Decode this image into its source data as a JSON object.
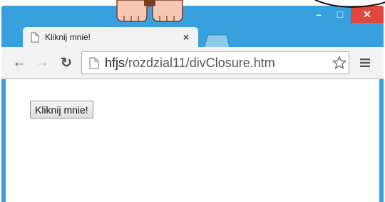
{
  "browser": {
    "tab_title": "Kliknij mnie!",
    "tab_close": "×",
    "url_host": "hfjs",
    "url_path": "/rozdzial11/divClosure.htm",
    "window_controls": {
      "minimize": "–",
      "maximize": "□",
      "close": "✕"
    },
    "colors": {
      "frame": "#38a0dd",
      "close_button": "#e0473d"
    }
  },
  "page": {
    "button_label": "Kliknij mnie!"
  },
  "icons": [
    "document-icon",
    "back-arrow-icon",
    "forward-arrow-icon",
    "reload-icon",
    "star-icon",
    "menu-icon",
    "new-tab-icon"
  ]
}
